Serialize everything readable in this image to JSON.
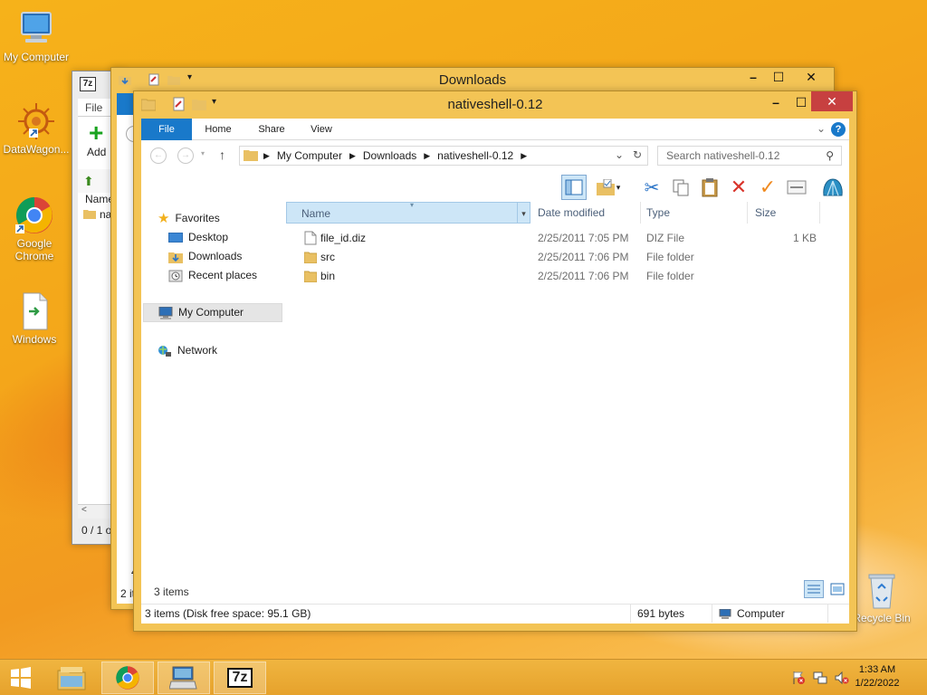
{
  "desktop": {
    "icons": [
      {
        "label": "My Computer"
      },
      {
        "label": "DataWagon..."
      },
      {
        "label": "Google Chrome"
      },
      {
        "label": "Windows"
      },
      {
        "label": "Recycle Bin"
      }
    ]
  },
  "sevenzip_window": {
    "app_icon_text": "7z",
    "menu_file": "File",
    "add_label": "Add",
    "col_name": "Name",
    "row_partial": "na",
    "status_partial": "0 / 1 o"
  },
  "downloads_window": {
    "title": "Downloads",
    "status_partial": "2 it",
    "partial_4": "4"
  },
  "explorer": {
    "title": "nativeshell-0.12",
    "tabs": {
      "file": "File",
      "home": "Home",
      "share": "Share",
      "view": "View"
    },
    "breadcrumb": [
      "My Computer",
      "Downloads",
      "nativeshell-0.12"
    ],
    "search_placeholder": "Search nativeshell-0.12",
    "nav": {
      "favorites": "Favorites",
      "desktop": "Desktop",
      "downloads": "Downloads",
      "recent": "Recent places",
      "my_computer": "My Computer",
      "network": "Network"
    },
    "columns": {
      "name": "Name",
      "date": "Date modified",
      "type": "Type",
      "size": "Size"
    },
    "files": [
      {
        "name": "file_id.diz",
        "date": "2/25/2011 7:05 PM",
        "type": "DIZ File",
        "size": "1 KB",
        "icon": "document-icon"
      },
      {
        "name": "src",
        "date": "2/25/2011 7:06 PM",
        "type": "File folder",
        "size": "",
        "icon": "folder-icon"
      },
      {
        "name": "bin",
        "date": "2/25/2011 7:06 PM",
        "type": "File folder",
        "size": "",
        "icon": "folder-icon"
      }
    ],
    "item_count": "3 items",
    "status_left": "3 items (Disk free space: 95.1 GB)",
    "status_mid": "691 bytes",
    "status_right": "Computer"
  },
  "taskbar": {
    "sevenzip_label": "7z",
    "time": "1:33 AM",
    "date": "1/22/2022"
  },
  "colors": {
    "ribbon_file_tab": "#1979ca",
    "selected_header": "#cde6f7",
    "nav_selected": "#e5e5e5",
    "close_button": "#c74040",
    "window_frame": "#f3c455"
  }
}
